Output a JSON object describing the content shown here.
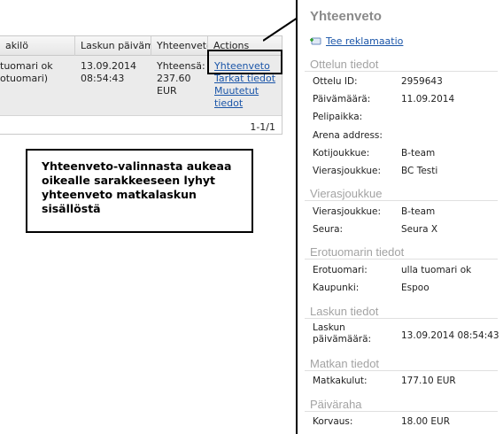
{
  "grid": {
    "columns": [
      "akilö",
      "Laskun päivämää",
      "Yhteenveto",
      "Actions"
    ],
    "row": {
      "person_line1": "tuomari ok",
      "person_line2": "otuomari)",
      "date_line1": "13.09.2014",
      "date_line2": "08:54:43",
      "total_label": "Yhteensä:",
      "total_amount": "237.60",
      "total_currency": "EUR",
      "actions": [
        "Yhteenveto",
        "Tarkat tiedot",
        "Muutetut",
        "tiedot"
      ]
    },
    "pager": "1-1/1"
  },
  "callout": {
    "lines": [
      "Yhteenveto-valinnasta aukeaa",
      "oikealle sarakkeeseen lyhyt",
      "yhteenveto matkalaskun",
      "sisällöstä"
    ]
  },
  "summary": {
    "title": "Yhteenveto",
    "complaint_link": "Tee reklamaatio",
    "sections": {
      "match": "Ottelun tiedot",
      "visitor": "Vierasjoukkue",
      "referee": "Erotuomarin tiedot",
      "invoice": "Laskun tiedot",
      "travel": "Matkan tiedot",
      "allowance": "Päiväraha"
    },
    "fields": {
      "match_id_label": "Ottelu ID:",
      "match_id": "2959643",
      "date_label": "Päivämäärä:",
      "date": "11.09.2014",
      "venue_label": "Pelipaikka:",
      "arena_label": "Arena address:",
      "home_label": "Kotijoukkue:",
      "home": "B-team",
      "away_label": "Vierasjoukkue:",
      "away": "BC Testi",
      "v_team_label": "Vierasjoukkue:",
      "v_team": "B-team",
      "club_label": "Seura:",
      "club": "Seura X",
      "ref_label": "Erotuomari:",
      "ref": "ulla tuomari ok",
      "city_label": "Kaupunki:",
      "city": "Espoo",
      "inv_label1": "Laskun",
      "inv_label2": "päivämäärä:",
      "inv_date": "13.09.2014 08:54:43",
      "travel_label": "Matkakulut:",
      "travel": "177.10 EUR",
      "comp_label": "Korvaus:",
      "comp": "18.00 EUR"
    }
  }
}
